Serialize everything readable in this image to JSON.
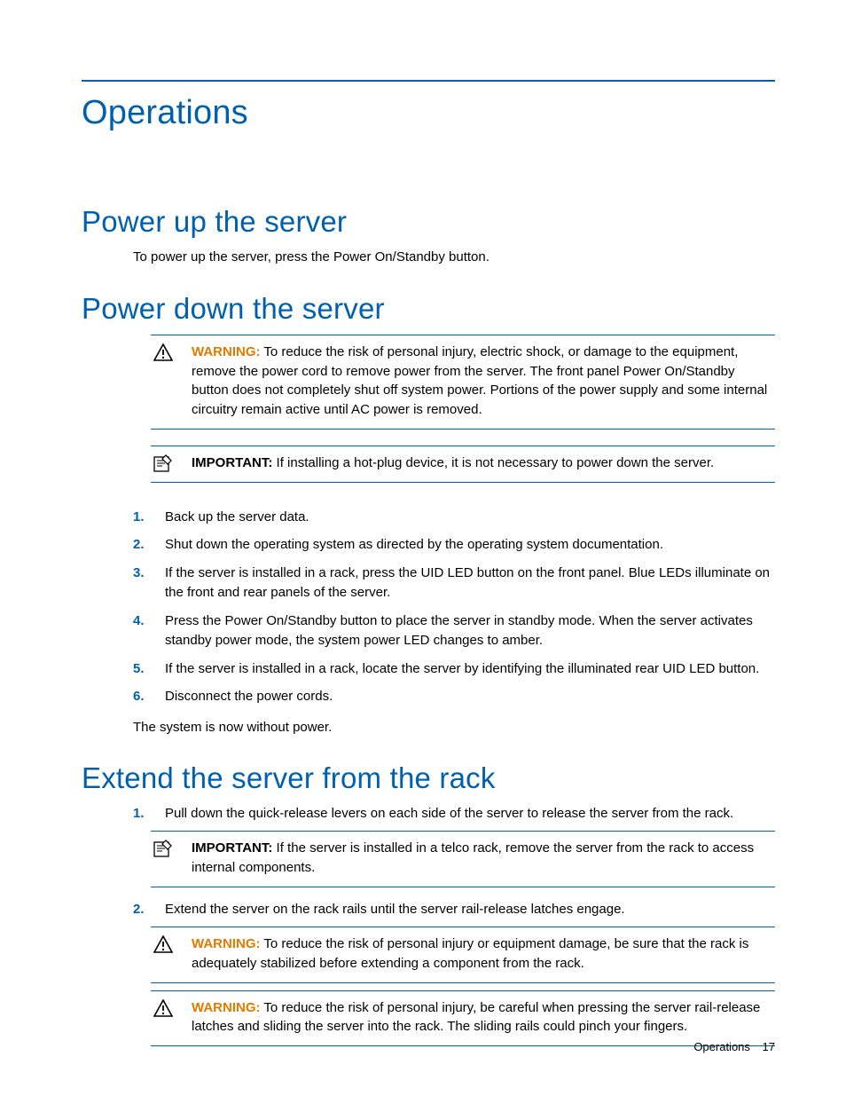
{
  "page_title": "Operations",
  "sections": {
    "powerup": {
      "heading": "Power up the server",
      "body": "To power up the server, press the Power On/Standby button."
    },
    "powerdown": {
      "heading": "Power down the server",
      "warning_label": "WARNING:",
      "warning_text": "  To reduce the risk of personal injury, electric shock, or damage to the equipment, remove the power cord to remove power from the server. The front panel Power On/Standby button does not completely shut off system power. Portions of the power supply and some internal circuitry remain active until AC power is removed.",
      "important_label": "IMPORTANT:",
      "important_text": "  If installing a hot-plug device, it is not necessary to power down the server.",
      "steps": [
        "Back up the server data.",
        "Shut down the operating system as directed by the operating system documentation.",
        "If the server is installed in a rack, press the UID LED button on the front panel. Blue LEDs illuminate on the front and rear panels of the server.",
        "Press the Power On/Standby button to place the server in standby mode. When the server activates standby power mode, the system power LED changes to amber.",
        "If the server is installed in a rack, locate the server by identifying the illuminated rear UID LED button.",
        "Disconnect the power cords."
      ],
      "closing": "The system is now without power."
    },
    "extend": {
      "heading": "Extend the server from the rack",
      "step1": "Pull down the quick-release levers on each side of the server to release the server from the rack.",
      "step1_important_label": "IMPORTANT:",
      "step1_important_text": "  If the server is installed in a telco rack, remove the server from the rack to access internal components.",
      "step2": "Extend the server on the rack rails until the server rail-release latches engage.",
      "step2_warn1_label": "WARNING:",
      "step2_warn1_text": "  To reduce the risk of personal injury or equipment damage, be sure that the rack is adequately stabilized before extending a component from the rack.",
      "step2_warn2_label": "WARNING:",
      "step2_warn2_text": "  To reduce the risk of personal injury, be careful when pressing the server rail-release latches and sliding the server into the rack. The sliding rails could pinch your fingers."
    }
  },
  "footer": {
    "section": "Operations",
    "page": "17"
  }
}
